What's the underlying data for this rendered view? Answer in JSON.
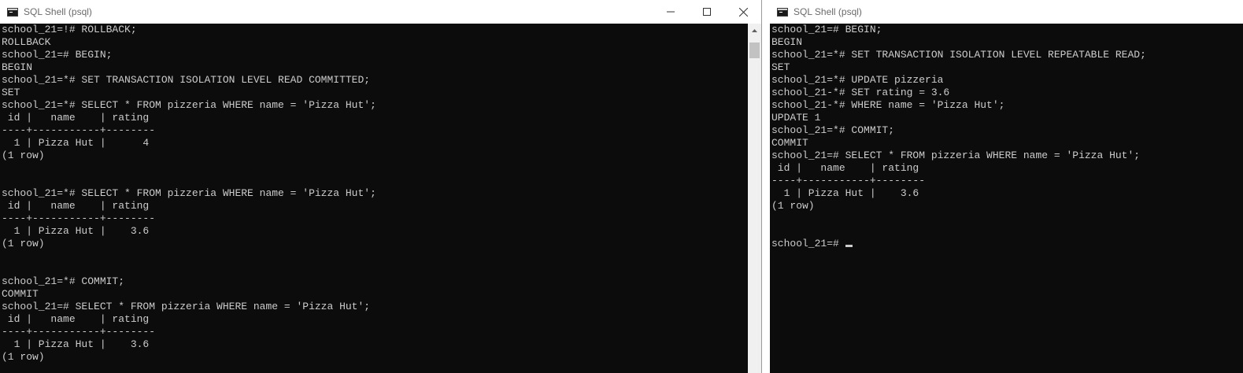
{
  "colors": {
    "console_bg": "#0c0c0c",
    "console_text": "#cccccc",
    "titlebar_bg": "#ffffff",
    "title_text": "#6a6a6a"
  },
  "left_window": {
    "title": "SQL Shell (psql)",
    "icon": "console-app-icon",
    "controls": {
      "minimize": "minimize-icon",
      "maximize": "maximize-icon",
      "close": "close-icon"
    },
    "lines": [
      "school_21=!# ROLLBACK;",
      "ROLLBACK",
      "school_21=# BEGIN;",
      "BEGIN",
      "school_21=*# SET TRANSACTION ISOLATION LEVEL READ COMMITTED;",
      "SET",
      "school_21=*# SELECT * FROM pizzeria WHERE name = 'Pizza Hut';",
      " id |   name    | rating",
      "----+-----------+--------",
      "  1 | Pizza Hut |      4",
      "(1 row)",
      "",
      "",
      "school_21=*# SELECT * FROM pizzeria WHERE name = 'Pizza Hut';",
      " id |   name    | rating",
      "----+-----------+--------",
      "  1 | Pizza Hut |    3.6",
      "(1 row)",
      "",
      "",
      "school_21=*# COMMIT;",
      "COMMIT",
      "school_21=# SELECT * FROM pizzeria WHERE name = 'Pizza Hut';",
      " id |   name    | rating",
      "----+-----------+--------",
      "  1 | Pizza Hut |    3.6",
      "(1 row)"
    ]
  },
  "right_window": {
    "title": "SQL Shell (psql)",
    "icon": "console-app-icon",
    "lines": [
      "school_21=# BEGIN;",
      "BEGIN",
      "school_21=*# SET TRANSACTION ISOLATION LEVEL REPEATABLE READ;",
      "SET",
      "school_21=*# UPDATE pizzeria",
      "school_21-*# SET rating = 3.6",
      "school_21-*# WHERE name = 'Pizza Hut';",
      "UPDATE 1",
      "school_21=*# COMMIT;",
      "COMMIT",
      "school_21=# SELECT * FROM pizzeria WHERE name = 'Pizza Hut';",
      " id |   name    | rating",
      "----+-----------+--------",
      "  1 | Pizza Hut |    3.6",
      "(1 row)",
      "",
      ""
    ],
    "prompt_line": "school_21=# "
  }
}
